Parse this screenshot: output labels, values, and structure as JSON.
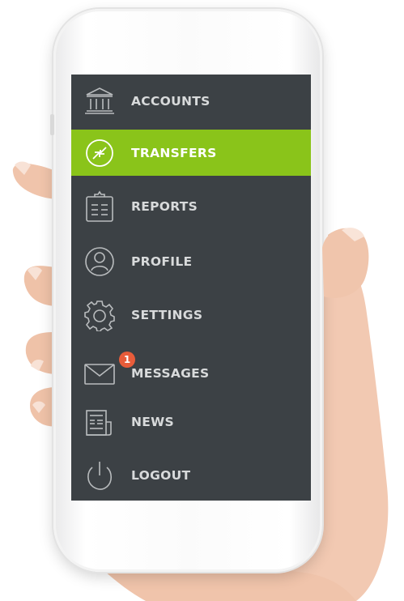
{
  "menu": {
    "items": [
      {
        "label": "ACCOUNTS",
        "icon": "bank-icon",
        "active": false
      },
      {
        "label": "TRANSFERS",
        "icon": "transfer-arrows-icon",
        "active": true
      },
      {
        "label": "REPORTS",
        "icon": "clipboard-icon",
        "active": false
      },
      {
        "label": "PROFILE",
        "icon": "user-icon",
        "active": false
      },
      {
        "label": "SETTINGS",
        "icon": "gear-icon",
        "active": false
      },
      {
        "label": "MESSAGES",
        "icon": "envelope-icon",
        "active": false,
        "badge": "1"
      },
      {
        "label": "NEWS",
        "icon": "newspaper-icon",
        "active": false
      },
      {
        "label": "LOGOUT",
        "icon": "power-icon",
        "active": false
      }
    ]
  },
  "colors": {
    "menu_background": "#3c4145",
    "active_background": "#8ac41a",
    "badge": "#e85c3a",
    "label": "#d8dadb"
  }
}
